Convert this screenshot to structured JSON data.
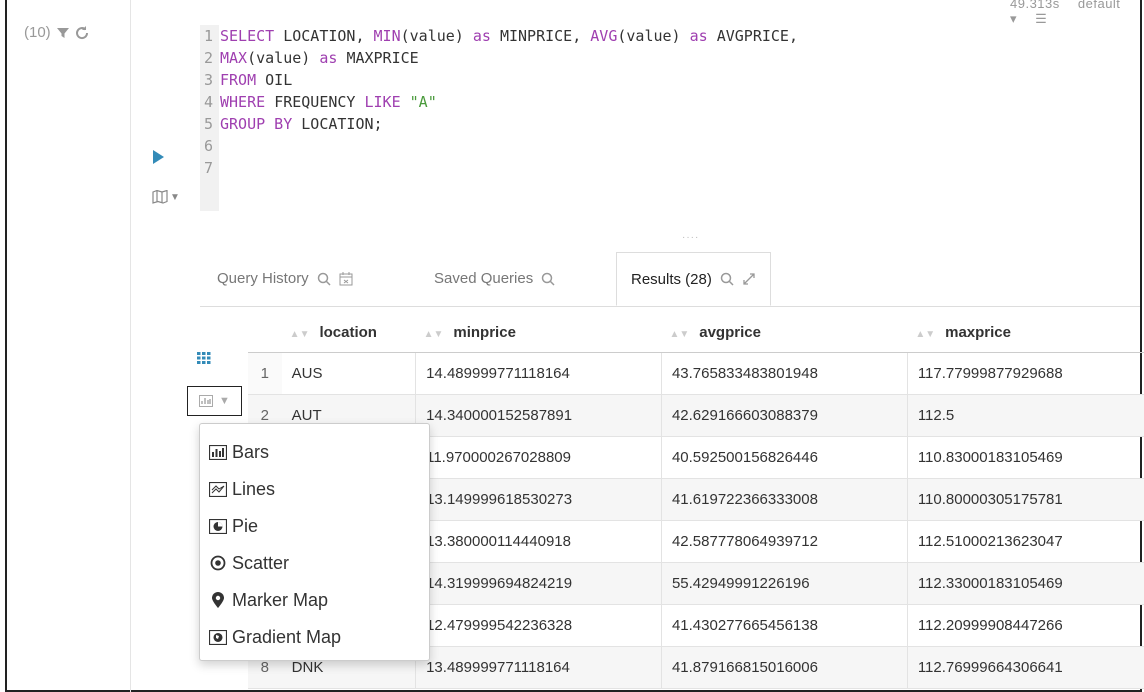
{
  "status": {
    "elapsed": "49.313s",
    "database": "default"
  },
  "history_count": "(10)",
  "editor": {
    "lines": [
      {
        "num": "1",
        "parts": [
          [
            "kw",
            "SELECT "
          ],
          [
            "id",
            "LOCATION, "
          ],
          [
            "fn",
            "MIN"
          ],
          [
            "id",
            "(value) "
          ],
          [
            "kw",
            "as "
          ],
          [
            "id",
            "MINPRICE, "
          ],
          [
            "fn",
            "AVG"
          ],
          [
            "id",
            "(value) "
          ],
          [
            "kw",
            "as "
          ],
          [
            "id",
            "AVGPRICE,"
          ]
        ]
      },
      {
        "num": "2",
        "parts": [
          [
            "fn",
            "MAX"
          ],
          [
            "id",
            "(value) "
          ],
          [
            "kw",
            "as "
          ],
          [
            "id",
            "MAXPRICE"
          ]
        ]
      },
      {
        "num": "3",
        "parts": [
          [
            "kw",
            "FROM "
          ],
          [
            "id",
            "OIL"
          ]
        ]
      },
      {
        "num": "4",
        "parts": [
          [
            "kw",
            "WHERE "
          ],
          [
            "id",
            "FREQUENCY "
          ],
          [
            "kw",
            "LIKE "
          ],
          [
            "str",
            "\"A\""
          ]
        ]
      },
      {
        "num": "5",
        "parts": [
          [
            "kw",
            "GROUP BY "
          ],
          [
            "id",
            "LOCATION;"
          ]
        ]
      },
      {
        "num": "6",
        "parts": []
      },
      {
        "num": "7",
        "parts": []
      }
    ]
  },
  "tabs": {
    "history": "Query History",
    "saved": "Saved Queries",
    "results": "Results (28)"
  },
  "table": {
    "columns": [
      "location",
      "minprice",
      "avgprice",
      "maxprice"
    ],
    "rows": [
      [
        "1",
        "AUS",
        "14.489999771118164",
        "43.765833483801948",
        "117.77999877929688"
      ],
      [
        "2",
        "AUT",
        "14.340000152587891",
        "42.629166603088379",
        "112.5"
      ],
      [
        "3",
        "",
        "11.970000267028809",
        "40.592500156826446",
        "110.83000183105469"
      ],
      [
        "4",
        "",
        "13.149999618530273",
        "41.619722366333008",
        "110.80000305175781"
      ],
      [
        "5",
        "",
        "13.380000114440918",
        "42.587778064939712",
        "112.51000213623047"
      ],
      [
        "6",
        "",
        "14.319999694824219",
        "55.42949991226196",
        "112.33000183105469"
      ],
      [
        "7",
        "",
        "12.479999542236328",
        "41.430277665456138",
        "112.20999908447266"
      ],
      [
        "8",
        "DNK",
        "13.489999771118164",
        "41.879166815016006",
        "112.76999664306641"
      ]
    ]
  },
  "chart_menu": {
    "bars": "Bars",
    "lines": "Lines",
    "pie": "Pie",
    "scatter": "Scatter",
    "marker_map": "Marker Map",
    "gradient_map": "Gradient Map"
  }
}
